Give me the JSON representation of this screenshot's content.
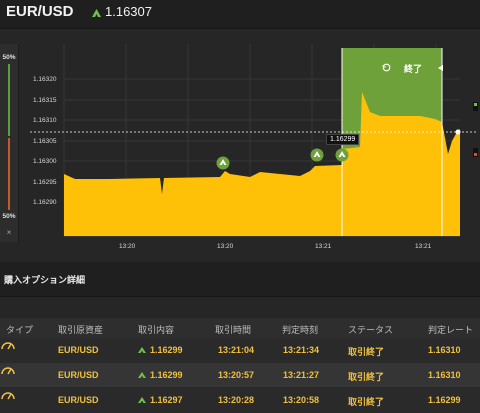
{
  "header": {
    "pair": "EUR/USD",
    "price": "1.16307",
    "direction_icon": "up-arrow-icon"
  },
  "side_panel": {
    "top_percent": "50%",
    "bottom_percent": "50%",
    "close_symbol": "×"
  },
  "chart_data": {
    "type": "area",
    "y_ticks": [
      "1.16320",
      "1.16315",
      "1.16310",
      "1.16305",
      "1.16300",
      "1.16295",
      "1.16290"
    ],
    "x_ticks": [
      "13:20",
      "13:20",
      "13:21",
      "13:21"
    ],
    "current_price_label": "1.16299",
    "end_label": "終了",
    "series": [
      {
        "color": "#ffc107"
      }
    ],
    "accent": "#6ea13a"
  },
  "section": {
    "title": "購入オプション詳細"
  },
  "table": {
    "headers": [
      "タイプ",
      "取引原資産",
      "取引内容",
      "取引時間",
      "判定時刻",
      "ステータス",
      "判定レート"
    ],
    "rows": [
      {
        "asset": "EUR/USD",
        "content": "1.16299",
        "time": "13:21:04",
        "judge": "13:21:34",
        "status": "取引終了",
        "rate": "1.16310"
      },
      {
        "asset": "EUR/USD",
        "content": "1.16299",
        "time": "13:20:57",
        "judge": "13:21:27",
        "status": "取引終了",
        "rate": "1.16310"
      },
      {
        "asset": "EUR/USD",
        "content": "1.16297",
        "time": "13:20:28",
        "judge": "13:20:58",
        "status": "取引終了",
        "rate": "1.16299"
      }
    ]
  }
}
